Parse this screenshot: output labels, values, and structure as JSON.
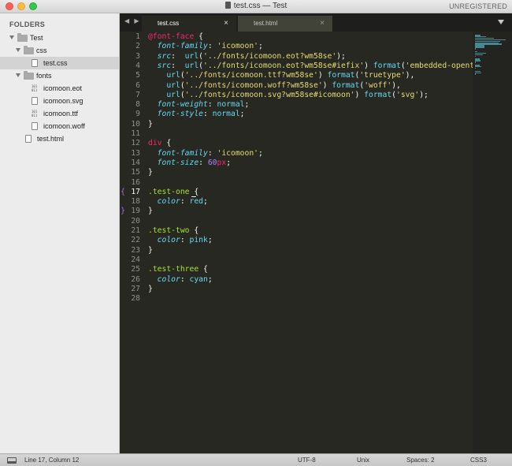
{
  "window": {
    "title": "test.css — Test",
    "registration": "UNREGISTERED",
    "accent_color": "#272822"
  },
  "sidebar": {
    "header": "FOLDERS",
    "items": [
      {
        "label": "Test",
        "kind": "folder"
      },
      {
        "label": "css",
        "kind": "folder"
      },
      {
        "label": "test.css",
        "kind": "file"
      },
      {
        "label": "fonts",
        "kind": "folder"
      },
      {
        "label": "icomoon.eot",
        "kind": "binary"
      },
      {
        "label": "icomoon.svg",
        "kind": "file"
      },
      {
        "label": "icomoon.ttf",
        "kind": "binary"
      },
      {
        "label": "icomoon.woff",
        "kind": "file"
      },
      {
        "label": "test.html",
        "kind": "file"
      }
    ]
  },
  "tabs": {
    "nav": "◀ ▶",
    "active": "test.css",
    "inactive": "test.html",
    "close_glyph": "×"
  },
  "editor": {
    "current_line": 17,
    "lines": [
      {
        "n": "1",
        "tokens": [
          [
            "at",
            "@font-face"
          ],
          [
            "plain",
            " {"
          ]
        ]
      },
      {
        "n": "2",
        "tokens": [
          [
            "plain",
            "  "
          ],
          [
            "prop",
            "font-family"
          ],
          [
            "plain",
            ": "
          ],
          [
            "str",
            "'icomoon'"
          ],
          [
            "plain",
            ";"
          ]
        ]
      },
      {
        "n": "3",
        "tokens": [
          [
            "plain",
            "  "
          ],
          [
            "prop",
            "src"
          ],
          [
            "plain",
            ":  "
          ],
          [
            "fn",
            "url"
          ],
          [
            "plain",
            "("
          ],
          [
            "str",
            "'../fonts/icomoon.eot?wm58se'"
          ],
          [
            "plain",
            ");"
          ]
        ]
      },
      {
        "n": "4",
        "tokens": [
          [
            "plain",
            "  "
          ],
          [
            "prop",
            "src"
          ],
          [
            "plain",
            ":  "
          ],
          [
            "fn",
            "url"
          ],
          [
            "plain",
            "("
          ],
          [
            "str",
            "'../fonts/icomoon.eot?wm58se#iefix'"
          ],
          [
            "plain",
            ") "
          ],
          [
            "fn",
            "format"
          ],
          [
            "plain",
            "("
          ],
          [
            "str",
            "'embedded-opent"
          ]
        ]
      },
      {
        "n": "5",
        "tokens": [
          [
            "plain",
            "    "
          ],
          [
            "fn",
            "url"
          ],
          [
            "plain",
            "("
          ],
          [
            "str",
            "'../fonts/icomoon.ttf?wm58se'"
          ],
          [
            "plain",
            ") "
          ],
          [
            "fn",
            "format"
          ],
          [
            "plain",
            "("
          ],
          [
            "str",
            "'truetype'"
          ],
          [
            "plain",
            "),"
          ]
        ]
      },
      {
        "n": "6",
        "tokens": [
          [
            "plain",
            "    "
          ],
          [
            "fn",
            "url"
          ],
          [
            "plain",
            "("
          ],
          [
            "str",
            "'../fonts/icomoon.woff?wm58se'"
          ],
          [
            "plain",
            ") "
          ],
          [
            "fn",
            "format"
          ],
          [
            "plain",
            "("
          ],
          [
            "str",
            "'woff'"
          ],
          [
            "plain",
            "),"
          ]
        ]
      },
      {
        "n": "7",
        "tokens": [
          [
            "plain",
            "    "
          ],
          [
            "fn",
            "url"
          ],
          [
            "plain",
            "("
          ],
          [
            "str",
            "'../fonts/icomoon.svg?wm58se#icomoon'"
          ],
          [
            "plain",
            ") "
          ],
          [
            "fn",
            "format"
          ],
          [
            "plain",
            "("
          ],
          [
            "str",
            "'svg'"
          ],
          [
            "plain",
            ");"
          ]
        ]
      },
      {
        "n": "8",
        "tokens": [
          [
            "plain",
            "  "
          ],
          [
            "prop",
            "font-weight"
          ],
          [
            "plain",
            ": "
          ],
          [
            "val",
            "normal"
          ],
          [
            "plain",
            ";"
          ]
        ]
      },
      {
        "n": "9",
        "tokens": [
          [
            "plain",
            "  "
          ],
          [
            "prop",
            "font-style"
          ],
          [
            "plain",
            ": "
          ],
          [
            "val",
            "normal"
          ],
          [
            "plain",
            ";"
          ]
        ]
      },
      {
        "n": "10",
        "tokens": [
          [
            "plain",
            "}"
          ]
        ]
      },
      {
        "n": "11",
        "tokens": []
      },
      {
        "n": "12",
        "tokens": [
          [
            "tag",
            "div"
          ],
          [
            "plain",
            " {"
          ]
        ]
      },
      {
        "n": "13",
        "tokens": [
          [
            "plain",
            "  "
          ],
          [
            "prop",
            "font-family"
          ],
          [
            "plain",
            ": "
          ],
          [
            "str",
            "'icomoon'"
          ],
          [
            "plain",
            ";"
          ]
        ]
      },
      {
        "n": "14",
        "tokens": [
          [
            "plain",
            "  "
          ],
          [
            "prop",
            "font-size"
          ],
          [
            "plain",
            ": "
          ],
          [
            "num",
            "60"
          ],
          [
            "unit",
            "px"
          ],
          [
            "plain",
            ";"
          ]
        ]
      },
      {
        "n": "15",
        "tokens": [
          [
            "plain",
            "}"
          ]
        ]
      },
      {
        "n": "16",
        "tokens": []
      },
      {
        "n": "17",
        "tokens": [
          [
            "cls",
            ".test-one"
          ],
          [
            "plain",
            " {"
          ]
        ]
      },
      {
        "n": "18",
        "tokens": [
          [
            "plain",
            "  "
          ],
          [
            "prop",
            "color"
          ],
          [
            "plain",
            ": "
          ],
          [
            "val",
            "red"
          ],
          [
            "plain",
            ";"
          ]
        ]
      },
      {
        "n": "19",
        "tokens": [
          [
            "plain",
            "}"
          ]
        ]
      },
      {
        "n": "20",
        "tokens": []
      },
      {
        "n": "21",
        "tokens": [
          [
            "cls",
            ".test-two"
          ],
          [
            "plain",
            " {"
          ]
        ]
      },
      {
        "n": "22",
        "tokens": [
          [
            "plain",
            "  "
          ],
          [
            "prop",
            "color"
          ],
          [
            "plain",
            ": "
          ],
          [
            "val",
            "pink"
          ],
          [
            "plain",
            ";"
          ]
        ]
      },
      {
        "n": "23",
        "tokens": [
          [
            "plain",
            "}"
          ]
        ]
      },
      {
        "n": "24",
        "tokens": []
      },
      {
        "n": "25",
        "tokens": [
          [
            "cls",
            ".test-three"
          ],
          [
            "plain",
            " {"
          ]
        ]
      },
      {
        "n": "26",
        "tokens": [
          [
            "plain",
            "  "
          ],
          [
            "prop",
            "color"
          ],
          [
            "plain",
            ": "
          ],
          [
            "val",
            "cyan"
          ],
          [
            "plain",
            ";"
          ]
        ]
      },
      {
        "n": "27",
        "tokens": [
          [
            "plain",
            "}"
          ]
        ]
      },
      {
        "n": "28",
        "tokens": []
      }
    ]
  },
  "status": {
    "position": "Line 17, Column 12",
    "encoding": "UTF-8",
    "line_endings": "Unix",
    "indentation": "Spaces: 2",
    "syntax": "CSS3"
  }
}
